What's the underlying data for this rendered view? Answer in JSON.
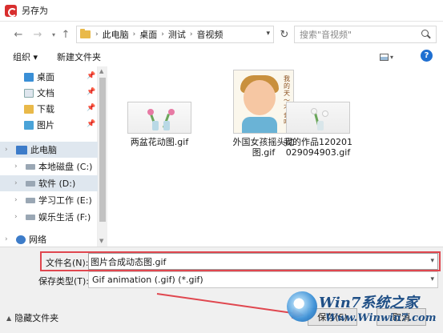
{
  "window": {
    "title": "另存为",
    "accent": "#d82e2e"
  },
  "address": {
    "crumbs": [
      "此电脑",
      "桌面",
      "测试",
      "音视频"
    ],
    "search_placeholder": "搜索\"音视频\""
  },
  "toolbar": {
    "organize": "组织 ▾",
    "new_folder": "新建文件夹"
  },
  "nav": {
    "quick": [
      {
        "label": "桌面",
        "icon": "desktop-icon"
      },
      {
        "label": "文档",
        "icon": "documents-icon"
      },
      {
        "label": "下载",
        "icon": "download-icon"
      },
      {
        "label": "图片",
        "icon": "pictures-icon"
      }
    ],
    "this_pc": "此电脑",
    "drives": [
      {
        "label": "本地磁盘 (C:)"
      },
      {
        "label": "软件 (D:)"
      },
      {
        "label": "学习工作 (E:)"
      },
      {
        "label": "娱乐生活 (F:)"
      }
    ],
    "network": "网络"
  },
  "files": [
    {
      "name": "两盆花动图.gif"
    },
    {
      "name": "外国女孩摇头动图.gif",
      "overlay_text": "我的天～不会吧"
    },
    {
      "name": "我的作品120201029094903.gif"
    }
  ],
  "bottom": {
    "filename_label": "文件名(N):",
    "filename_value": "图片合成动态图.gif",
    "filetype_label": "保存类型(T):",
    "filetype_value": "Gif animation (.gif) (*.gif)",
    "hide_folders": "隐藏文件夹",
    "save": "保存(S)",
    "cancel": "取消"
  },
  "watermark": {
    "brand": "Win7系统之家",
    "url": "Www.Winwin7.com"
  },
  "colors": {
    "highlight": "#e0474f",
    "selection": "#dfe7ef"
  }
}
